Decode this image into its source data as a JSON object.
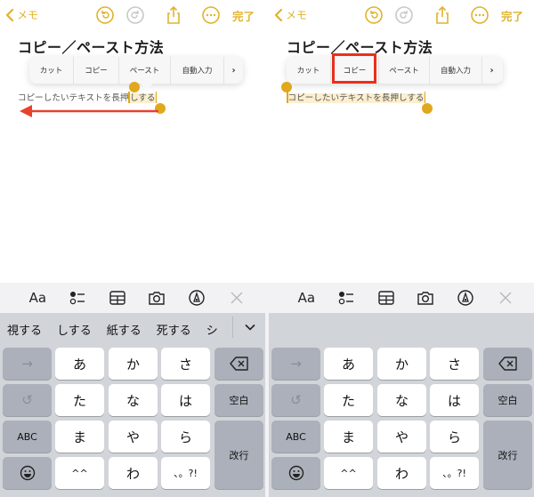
{
  "panels": [
    {
      "id": "left",
      "nav": {
        "back_label": "メモ",
        "done_label": "完了"
      },
      "note_title": "コピー／ペースト方法",
      "edit_menu": {
        "items": [
          "カット",
          "コピー",
          "ペースト",
          "自動入力",
          "›"
        ],
        "highlighted": null
      },
      "body": {
        "before": "コピーしたいテキストを長押",
        "selected": "しする",
        "after": ""
      },
      "annotation": {
        "type": "left-arrow",
        "color": "#e8412c"
      },
      "candidates": [
        "視する",
        "しする",
        "紙する",
        "死する",
        "シ"
      ],
      "candidates_visible": true
    },
    {
      "id": "right",
      "nav": {
        "back_label": "メモ",
        "done_label": "完了"
      },
      "note_title": "コピー／ペースト方法",
      "edit_menu": {
        "items": [
          "カット",
          "コピー",
          "ペースト",
          "自動入力",
          "›"
        ],
        "highlighted": "コピー",
        "highlight_color": "#e8301c"
      },
      "body": {
        "before": "",
        "selected": "コピーしたいテキストを長押しする",
        "after": ""
      },
      "candidates": [],
      "candidates_visible": false
    }
  ],
  "toolbar": {
    "items": [
      "format-Aa",
      "checklist",
      "table",
      "camera",
      "markup",
      "close"
    ],
    "format_label": "Aa"
  },
  "keyboard": {
    "row1": [
      "→",
      "あ",
      "か",
      "さ",
      "⌫"
    ],
    "row2": [
      "↺",
      "た",
      "な",
      "は",
      "空白"
    ],
    "row3": [
      "ABC",
      "ま",
      "や",
      "ら",
      "改行"
    ],
    "row4": [
      "☺",
      "^^",
      "わ",
      "、。?!"
    ]
  },
  "colors": {
    "accent": "#e0b32c",
    "selection_handle": "#e0a81c",
    "selection_bg": "#fbefcf",
    "annotation_red": "#e8412c",
    "keyboard_bg": "#d1d4d9",
    "function_key": "#abb0ba"
  }
}
